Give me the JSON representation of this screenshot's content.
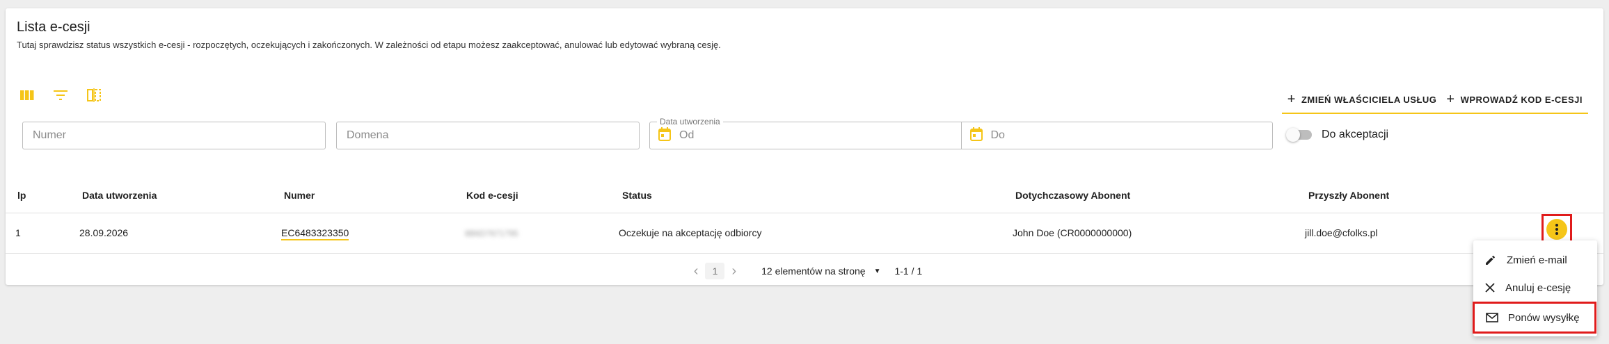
{
  "header": {
    "title": "Lista e-cesji",
    "subtitle": "Tutaj sprawdzisz status wszystkich e-cesji - rozpoczętych, oczekujących i zakończonych. W zależności od etapu możesz zaakceptować, anulować lub edytować wybraną cesję."
  },
  "toolbar": {
    "icons": [
      "columns-icon",
      "filter-icon",
      "density-icon"
    ],
    "change_owner_label": "ZMIEŃ WŁAŚCICIELA USŁUG",
    "enter_code_label": "WPROWADŹ KOD E-CESJI"
  },
  "filters": {
    "number_placeholder": "Numer",
    "domain_placeholder": "Domena",
    "date_legend": "Data utworzenia",
    "date_from_placeholder": "Od",
    "date_to_placeholder": "Do",
    "accept_toggle_label": "Do akceptacji"
  },
  "table": {
    "headers": [
      "lp",
      "Data utworzenia",
      "Numer",
      "Kod e-cesji",
      "Status",
      "Dotychczasowy Abonent",
      "Przyszły Abonent"
    ],
    "rows": [
      {
        "lp": "1",
        "date": "28.09.2026",
        "number": "EC6483323350",
        "code": "8B6D7671795",
        "status": "Oczekuje na akceptację odbiorcy",
        "prev_subscriber": "John Doe (CR0000000000)",
        "next_subscriber": "jill.doe@cfolks.pl"
      }
    ]
  },
  "pagination": {
    "current_page": "1",
    "per_page_label": "12 elementów na stronę",
    "range": "1-1 / 1"
  },
  "row_menu": {
    "items": [
      {
        "label": "Zmień e-mail",
        "icon": "pencil-icon"
      },
      {
        "label": "Anuluj e-cesję",
        "icon": "close-icon"
      },
      {
        "label": "Ponów wysyłkę",
        "icon": "mail-icon"
      }
    ]
  },
  "colors": {
    "accent": "#f5c518",
    "highlight": "#e01b1b"
  }
}
